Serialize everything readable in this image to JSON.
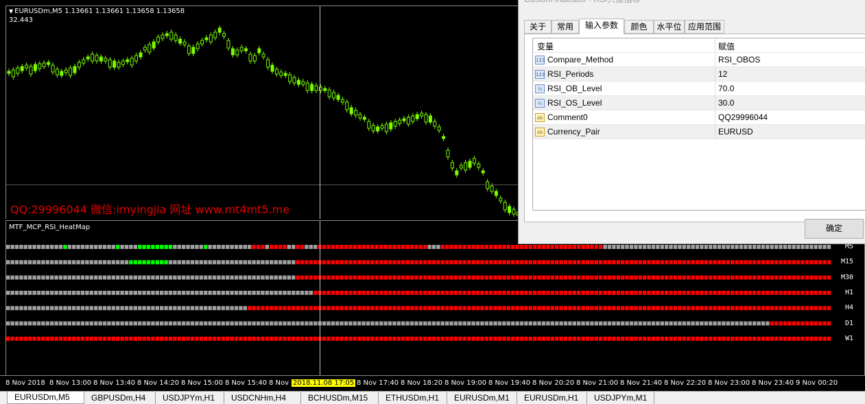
{
  "chart": {
    "symbol_label": "EURUSDm,M5  1.13661 1.13661 1.13658 1.13658",
    "level_value": "32.443",
    "watermark": "QQ:29996044 微信:imyingjia 网址 www.mt4mt5.me",
    "candle_color": "#7CFC00",
    "indicator_title": "MTF_MCP_RSI_HeatMap",
    "timeframes": [
      "M5",
      "M15",
      "M30",
      "H1",
      "H4",
      "D1",
      "W1"
    ],
    "heat_colors": {
      "gray": "#a0a0a0",
      "red": "#ff0000",
      "green": "#00ff00"
    },
    "time_labels": [
      "8 Nov 2018",
      "8 Nov 13:00",
      "8 Nov 13:40",
      "8 Nov 14:20",
      "8 Nov 15:00",
      "8 Nov 15:40",
      "8 Nov 1",
      "8 Nov 17:40",
      "8 Nov 18:20",
      "8 Nov 19:00",
      "8 Nov 19:40",
      "8 Nov 20:20",
      "8 Nov 21:00",
      "8 Nov 21:40",
      "8 Nov 22:20",
      "8 Nov 23:00",
      "8 Nov 23:40",
      "9 Nov 00:20"
    ],
    "crosshair_time": "2018.11.08 17:05"
  },
  "tabs": [
    "EURUSDm,M5",
    "GBPUSDm,H4",
    "USDJPYm,H1",
    "USDCNHm,H4",
    "BCHUSDm,M15",
    "ETHUSDm,H1",
    "EURUSDm,M1",
    "EURUSDm,H1",
    "USDJPYm,M1"
  ],
  "dialog": {
    "title": "Custom Indicator - RSI共振指标",
    "tabs": [
      "关于",
      "常用",
      "输入参数",
      "颜色",
      "水平位",
      "应用范围"
    ],
    "active_tab": "输入参数",
    "columns": [
      "变量",
      "赋值"
    ],
    "params": [
      {
        "type": "123",
        "name": "Compare_Method",
        "value": "RSI_OBOS"
      },
      {
        "type": "123",
        "name": "RSI_Periods",
        "value": "12"
      },
      {
        "type": "½",
        "name": "RSI_OB_Level",
        "value": "70.0"
      },
      {
        "type": "½",
        "name": "RSI_OS_Level",
        "value": "30.0"
      },
      {
        "type": "ab",
        "name": "Comment0",
        "value": "QQ29996044"
      },
      {
        "type": "ab",
        "name": "Currency_Pair",
        "value": "EURUSD"
      }
    ],
    "ok_label": "确定"
  }
}
